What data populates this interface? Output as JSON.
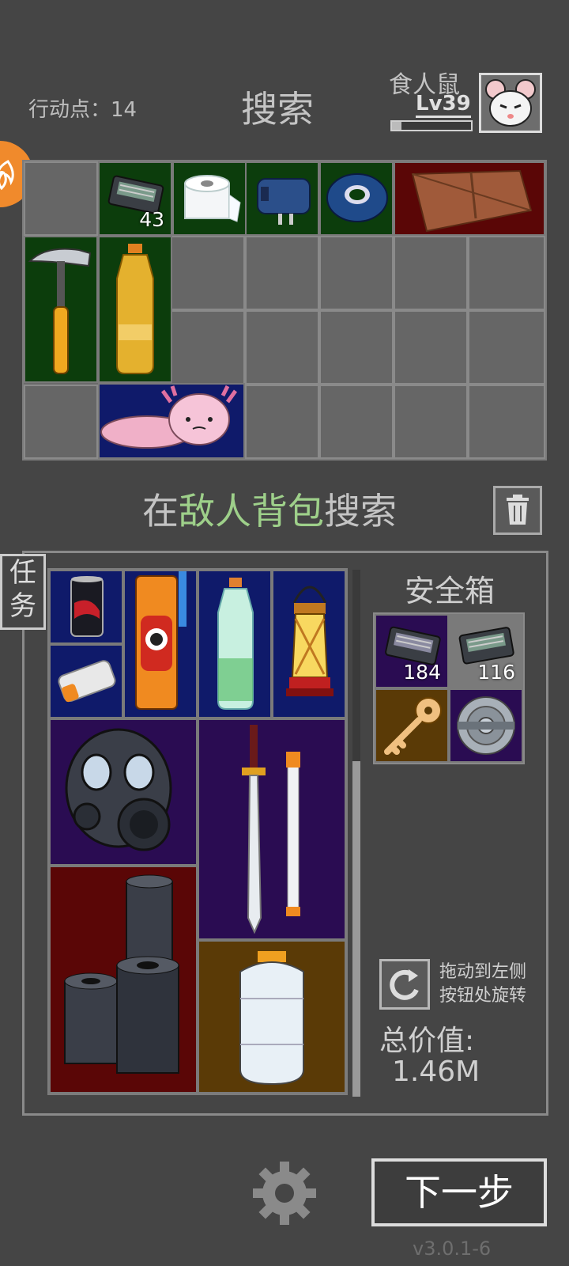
{
  "header": {
    "action_points": "行动点：14",
    "title": "搜索",
    "player_name": "食人鼠",
    "player_level": "Lv39",
    "xp_progress": 0.12
  },
  "player_grid": {
    "items": [
      {
        "name": "gun-parts-crate",
        "count": "43",
        "bg": "green"
      },
      {
        "name": "toilet-paper",
        "bg": "green"
      },
      {
        "name": "power-adapter",
        "bg": "green"
      },
      {
        "name": "tape-roll",
        "bg": "green"
      },
      {
        "name": "leather-wallet",
        "bg": "red"
      },
      {
        "name": "hammer",
        "bg": "green"
      },
      {
        "name": "oil-bottle",
        "bg": "green"
      },
      {
        "name": "axolotl-plush",
        "bg": "navy"
      }
    ]
  },
  "search": {
    "prefix": "在",
    "highlight": "敌人背包",
    "suffix": "搜索"
  },
  "task_tab": {
    "line1": "任",
    "line2": "务"
  },
  "enemy_bag": {
    "items": [
      {
        "name": "soda-can",
        "bg": "navy"
      },
      {
        "name": "snack-tube",
        "bg": "navy"
      },
      {
        "name": "water-bottle",
        "bg": "navy"
      },
      {
        "name": "oil-lantern",
        "bg": "navy"
      },
      {
        "name": "power-bank",
        "bg": "navy"
      },
      {
        "name": "gas-mask",
        "bg": "purple"
      },
      {
        "name": "katana",
        "bg": "purple"
      },
      {
        "name": "metal-cylinders",
        "bg": "red"
      },
      {
        "name": "liquid-nitrogen-tank",
        "bg": "brown"
      }
    ]
  },
  "safe_box": {
    "label": "安全箱",
    "items": [
      {
        "name": "gun-parts-crate",
        "count": "184",
        "bg": "purple"
      },
      {
        "name": "gun-parts-crate-2",
        "count": "116",
        "bg": "gray"
      },
      {
        "name": "key",
        "bg": "brown"
      },
      {
        "name": "metal-disc",
        "bg": "purple"
      }
    ]
  },
  "rotate_hint": {
    "line1": "拖动到左侧",
    "line2": "按钮处旋转"
  },
  "total": {
    "label": "总价值:",
    "value": "1.46M"
  },
  "next_button": "下一步",
  "version": "v3.0.1-6"
}
